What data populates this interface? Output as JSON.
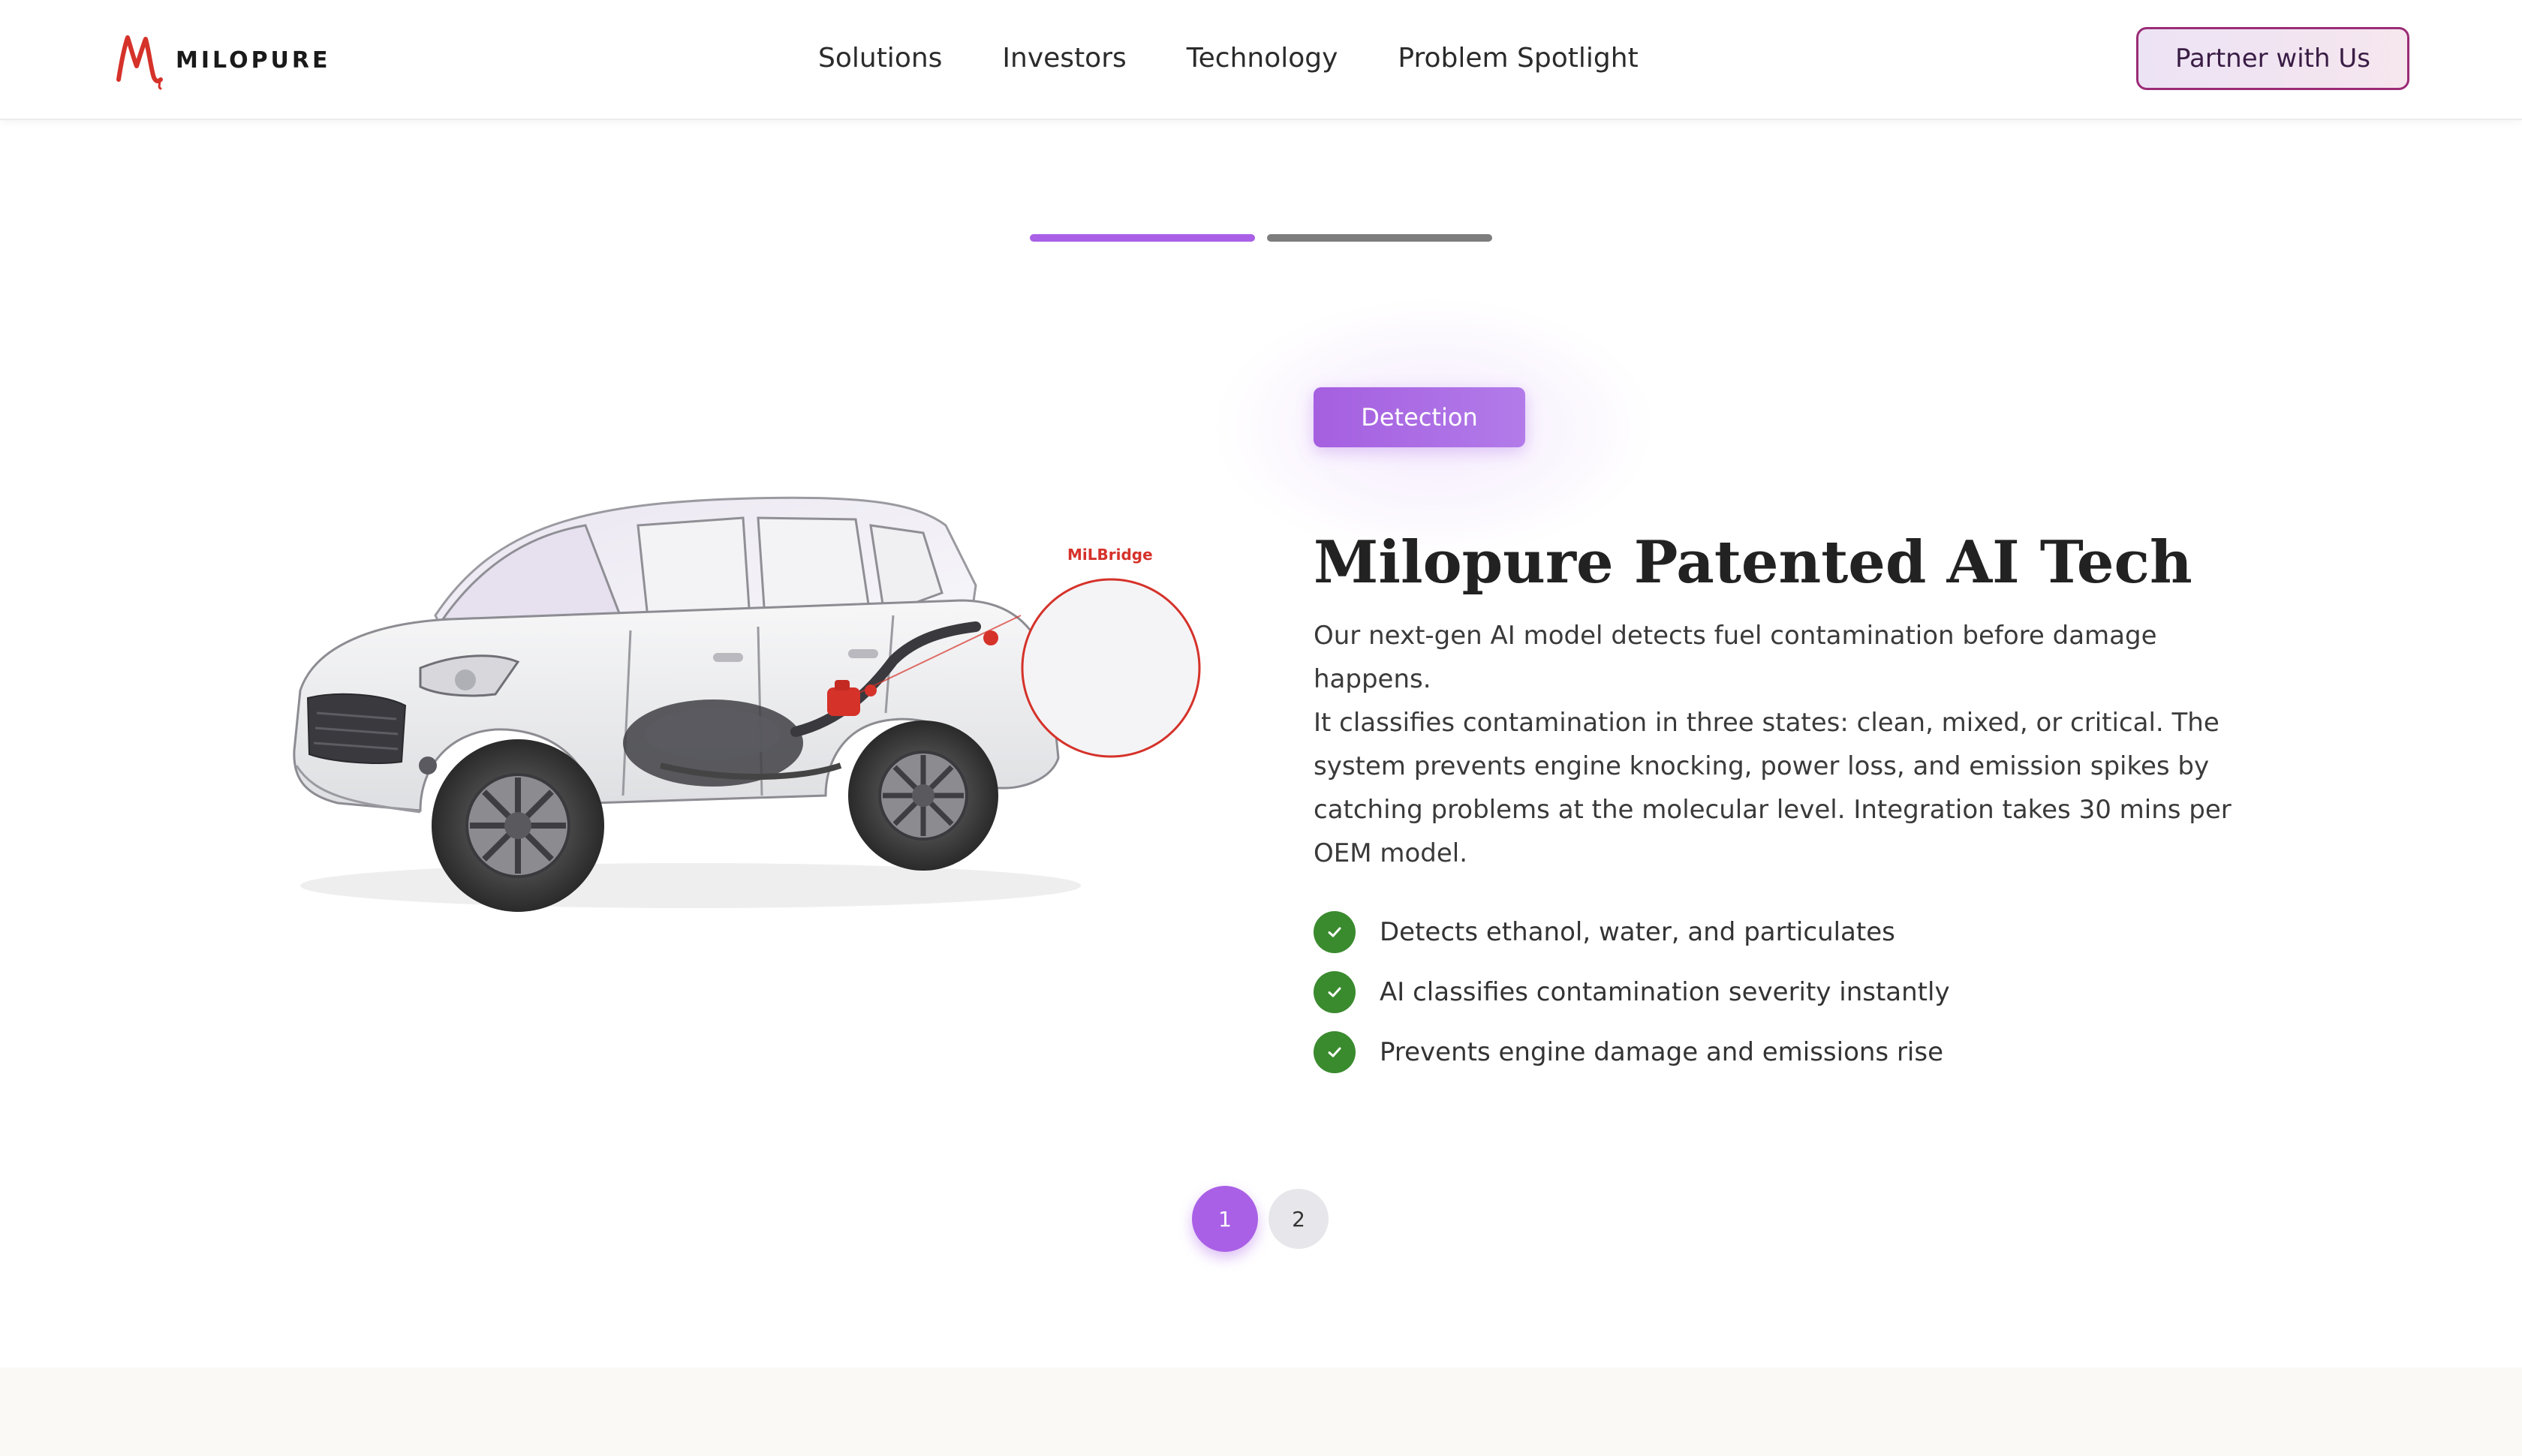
{
  "brand": {
    "name": "MILOPURE",
    "accent": "#a960e6",
    "logo_red": "#d5322a"
  },
  "nav": {
    "items": [
      "Solutions",
      "Investors",
      "Technology",
      "Problem Spotlight"
    ]
  },
  "header": {
    "cta_label": "Partner with Us"
  },
  "slider": {
    "current_slide": 1,
    "total_slides": 2,
    "pages": [
      "1",
      "2"
    ]
  },
  "illustration": {
    "callout_label": "MiLBridge",
    "callout_color": "#d5322a"
  },
  "content": {
    "badge": "Detection",
    "title": "Milopure Patented AI Tech",
    "paragraph1": "Our next-gen AI model detects fuel contamination before damage happens.",
    "paragraph2": "It classifies contamination in three states: clean, mixed, or critical. The system prevents engine knocking, power loss, and emission spikes by catching problems at the molecular level. Integration takes 30 mins per OEM model.",
    "features": [
      "Detects ethanol, water, and particulates",
      "AI classifies contamination severity instantly",
      "Prevents engine damage and emissions rise"
    ],
    "check_color": "#3a8a2e"
  }
}
